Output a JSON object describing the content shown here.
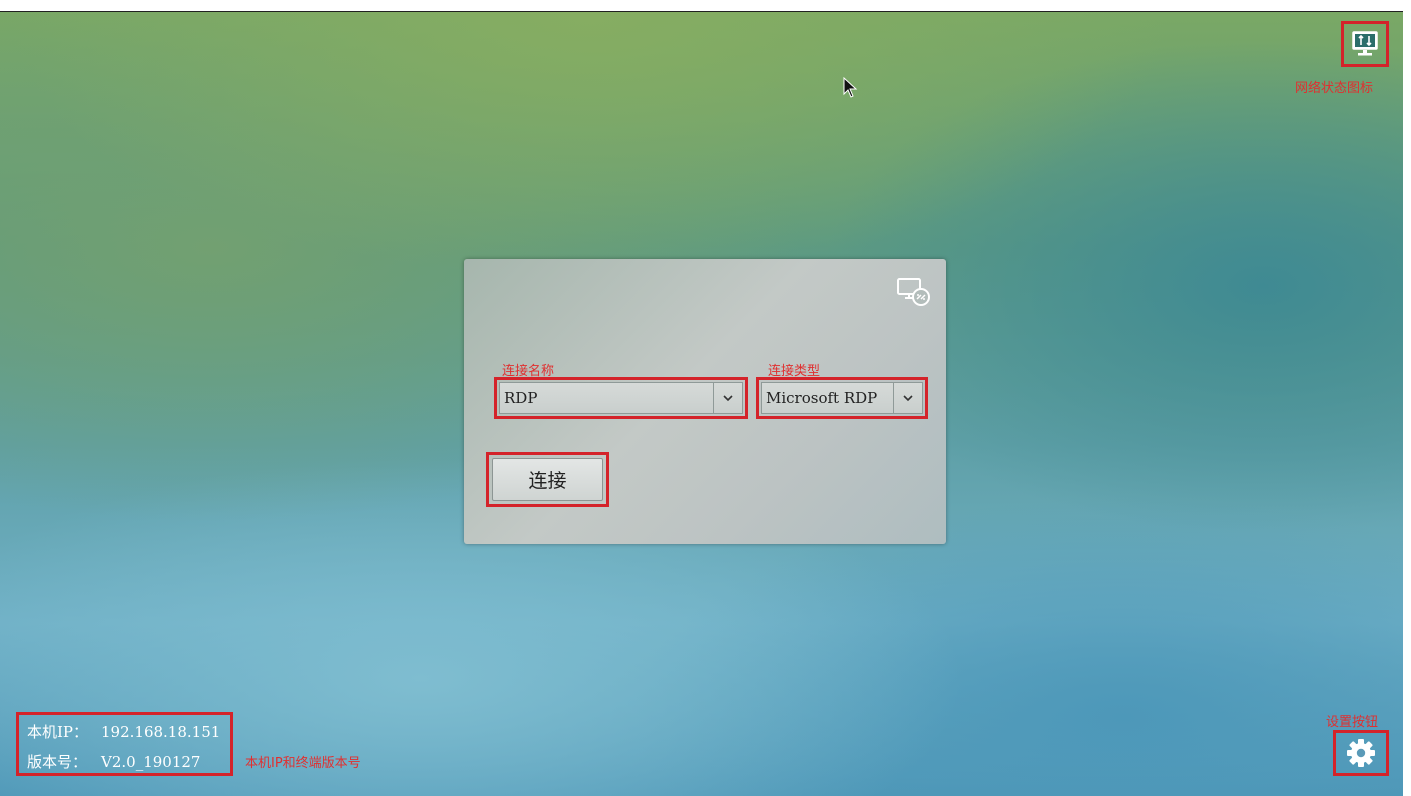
{
  "network": {
    "icon": "network-status-icon",
    "annotation": "网络状态图标"
  },
  "dialog": {
    "icon": "remote-desktop-icon",
    "connection_name_annotation": "连接名称",
    "connection_name_value": "RDP",
    "connection_type_annotation": "连接类型",
    "connection_type_value": "Microsoft RDP",
    "connect_button": "连接"
  },
  "info": {
    "ip_label": "本机IP：",
    "ip_value": "192.168.18.151",
    "version_label": "版本号：",
    "version_value": "V2.0_190127",
    "annotation": "本机IP和终端版本号"
  },
  "settings": {
    "icon": "gear-icon",
    "annotation": "设置按钮"
  },
  "colors": {
    "annotation_red": "#d4232a",
    "dialog_bg": "#bcc3c3"
  }
}
